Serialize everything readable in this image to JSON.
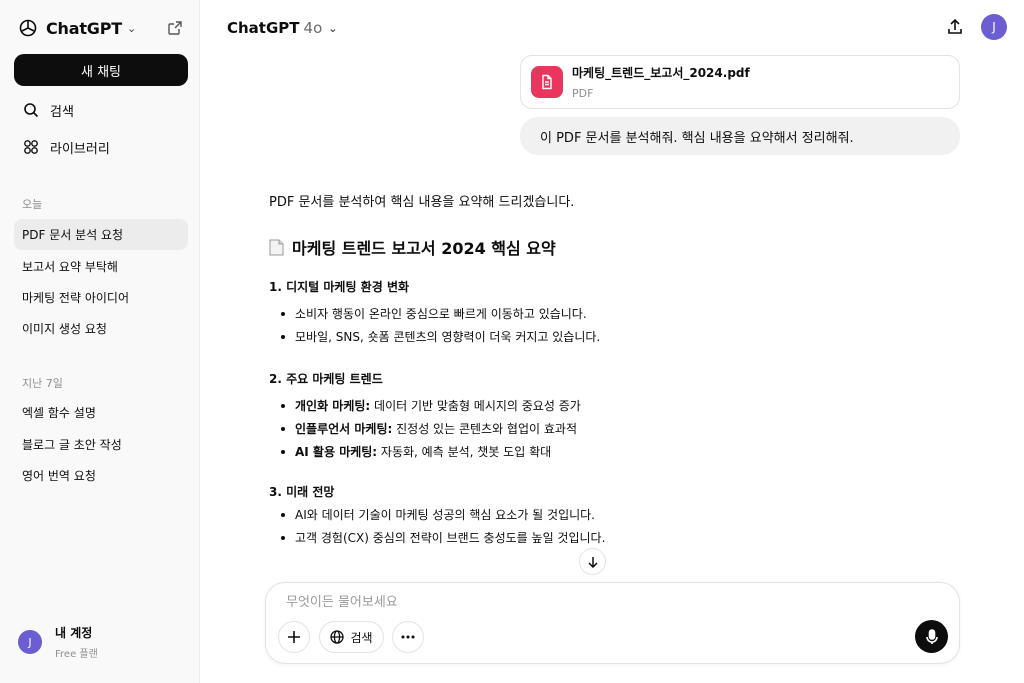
{
  "sidebar": {
    "brand": "ChatGPT",
    "new_chat_label": "새 채팅",
    "nav": {
      "search": "검색",
      "library": "라이브러리"
    },
    "today_label": "오늘",
    "today_items": [
      "PDF 문서 분석 요청",
      "보고서 요약 부탁해",
      "마케팅 전략 아이디어",
      "이미지 생성 요청"
    ],
    "last7_label": "지난 7일",
    "last7_items": [
      "엑셀 함수 설명",
      "블로그 글 초안 작성",
      "영어 번역 요청"
    ],
    "account": {
      "initial": "J",
      "name": "내 계정",
      "plan": "Free 플랜"
    }
  },
  "header": {
    "model": "ChatGPT",
    "version": "4o",
    "user_initial": "J"
  },
  "attachment": {
    "filename": "마케팅_트렌드_보고서_2024.pdf",
    "type": "PDF"
  },
  "user_message": "이 PDF 문서를 분석해줘. 핵심 내용을 요약해서 정리해줘.",
  "response": {
    "intro": "PDF 문서를 분석하여 핵심 내용을 요약해 드리겠습니다.",
    "title": "마케팅 트렌드 보고서 2024 핵심 요약",
    "sections": [
      {
        "heading": "1. 디지털 마케팅 환경 변화",
        "bullets": [
          {
            "bold": "",
            "text": "소비자 행동이 온라인 중심으로 빠르게 이동하고 있습니다."
          },
          {
            "bold": "",
            "text": "모바일, SNS, 숏폼 콘텐츠의 영향력이 더욱 커지고 있습니다."
          }
        ]
      },
      {
        "heading": "2. 주요 마케팅 트렌드",
        "bullets": [
          {
            "bold": "개인화 마케팅:",
            "text": " 데이터 기반 맞춤형 메시지의 중요성 증가"
          },
          {
            "bold": "인플루언서 마케팅:",
            "text": " 진정성 있는 콘텐츠와 협업이 효과적"
          },
          {
            "bold": "AI 활용 마케팅:",
            "text": " 자동화, 예측 분석, 챗봇 도입 확대"
          }
        ]
      },
      {
        "heading": "3. 미래 전망",
        "bullets": [
          {
            "bold": "",
            "text": "AI와 데이터 기술이 마케팅 성공의 핵심 요소가 될 것입니다."
          },
          {
            "bold": "",
            "text": "고객 경험(CX) 중심의 전략이 브랜드 충성도를 높일 것입니다."
          }
        ]
      }
    ]
  },
  "composer": {
    "placeholder": "무엇이든 물어보세요",
    "search_label": "검색"
  },
  "colors": {
    "pdf_icon": "#e8365d",
    "avatar": "#6c5dd3"
  },
  "icons": [
    "chatgpt-logo-icon",
    "chevron-down-icon",
    "new-window-icon",
    "search-icon",
    "library-icon",
    "share-icon",
    "file-icon",
    "document-icon",
    "arrow-down-icon",
    "plus-icon",
    "globe-icon",
    "more-icon",
    "mic-icon"
  ]
}
